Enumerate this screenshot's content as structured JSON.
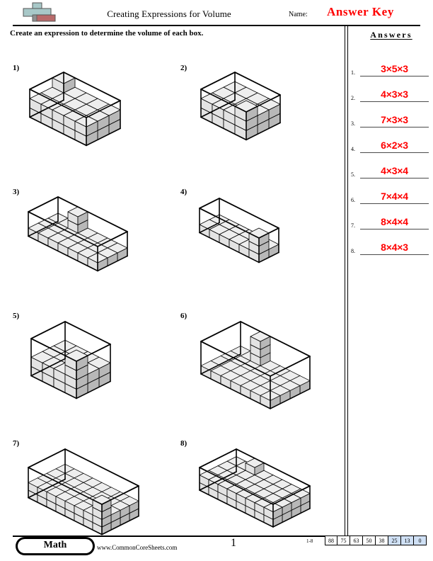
{
  "header": {
    "title": "Creating Expressions for Volume",
    "name_label": "Name:",
    "answer_key": "Answer Key",
    "logo_icon": "commoncore-plus-logo"
  },
  "instruction": "Create an expression to determine the volume of each box.",
  "answers_panel": {
    "heading": "Answers",
    "items": [
      {
        "number": "1.",
        "value": "3×5×3"
      },
      {
        "number": "2.",
        "value": "4×3×3"
      },
      {
        "number": "3.",
        "value": "7×3×3"
      },
      {
        "number": "4.",
        "value": "6×2×3"
      },
      {
        "number": "5.",
        "value": "4×3×4"
      },
      {
        "number": "6.",
        "value": "7×4×4"
      },
      {
        "number": "7.",
        "value": "8×4×4"
      },
      {
        "number": "8.",
        "value": "8×4×3"
      }
    ]
  },
  "problems": [
    {
      "label": "1)",
      "expression": "3×5×3",
      "length": 5,
      "width": 3,
      "height": 3,
      "filled_layers": 2,
      "stack_col": 0,
      "stack_row": 0,
      "stack_height": 3
    },
    {
      "label": "2)",
      "expression": "4×3×3",
      "length": 4,
      "width": 3,
      "height": 3,
      "filled_layers": 2,
      "stack_col": 3,
      "stack_row": 2,
      "stack_height": 3
    },
    {
      "label": "3)",
      "expression": "7×3×3",
      "length": 7,
      "width": 3,
      "height": 3,
      "filled_layers": 1,
      "stack_col": 2,
      "stack_row": 0,
      "stack_height": 3
    },
    {
      "label": "4)",
      "expression": "6×2×3",
      "length": 6,
      "width": 2,
      "height": 3,
      "filled_layers": 1,
      "stack_col": 5,
      "stack_row": 1,
      "stack_height": 3
    },
    {
      "label": "5)",
      "expression": "4×3×4",
      "length": 4,
      "width": 3,
      "height": 4,
      "filled_layers": 2,
      "stack_col": 3,
      "stack_row": 2,
      "stack_height": 4
    },
    {
      "label": "6)",
      "expression": "7×4×4",
      "length": 7,
      "width": 4,
      "height": 4,
      "filled_layers": 1,
      "stack_col": 2,
      "stack_row": 0,
      "stack_height": 4
    },
    {
      "label": "7)",
      "expression": "8×4×4",
      "length": 8,
      "width": 4,
      "height": 4,
      "filled_layers": 2,
      "stack_col": 7,
      "stack_row": 3,
      "stack_height": 4
    },
    {
      "label": "8)",
      "expression": "8×4×3",
      "length": 8,
      "width": 4,
      "height": 3,
      "filled_layers": 2,
      "stack_col": 2,
      "stack_row": 0,
      "stack_height": 3
    }
  ],
  "footer": {
    "badge": "Math",
    "website": "www.CommonCoreSheets.com",
    "page_number": "1",
    "scale_range": "1-8",
    "scale_values": [
      "88",
      "75",
      "63",
      "50",
      "38",
      "25",
      "13",
      "0"
    ],
    "scale_highlighted": [
      "25",
      "13",
      "0"
    ],
    "highlight_color": "#cfe0f5"
  },
  "colors": {
    "answer_red": "#ff0000",
    "cube_top": "#eeeeee",
    "cube_left": "#e3e3e3",
    "cube_right": "#b8b8b8",
    "outline": "#000000"
  }
}
